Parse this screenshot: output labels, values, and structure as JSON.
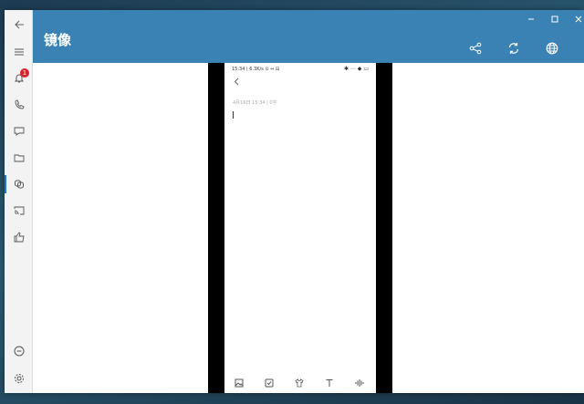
{
  "window": {
    "title": "镜像"
  },
  "sidebar": {
    "items": [
      {
        "name": "back",
        "icon": "back-arrow-icon"
      },
      {
        "name": "menu",
        "icon": "hamburger-menu-icon"
      },
      {
        "name": "notifications",
        "icon": "bell-icon",
        "badge": "1"
      },
      {
        "name": "calls",
        "icon": "phone-icon"
      },
      {
        "name": "messages",
        "icon": "chat-bubble-icon"
      },
      {
        "name": "files",
        "icon": "folder-icon"
      },
      {
        "name": "mirror",
        "icon": "mirror-icon",
        "active": true
      },
      {
        "name": "cast",
        "icon": "cast-icon"
      },
      {
        "name": "like",
        "icon": "thumbs-up-icon"
      },
      {
        "name": "disconnect",
        "icon": "minus-circle-icon"
      },
      {
        "name": "settings",
        "icon": "gear-icon"
      }
    ]
  },
  "header": {
    "actions": [
      "share-icon",
      "refresh-icon",
      "globe-icon"
    ]
  },
  "phone": {
    "status_left": "15:34 | 6.3K/s ⊙ ⇔ ⊟",
    "status_right": "✱ ⋯ ◆ ▭",
    "note_meta": "4月16日 15:34 | 0字"
  },
  "colors": {
    "accent": "#3a82b4",
    "badge": "#d4232a"
  }
}
